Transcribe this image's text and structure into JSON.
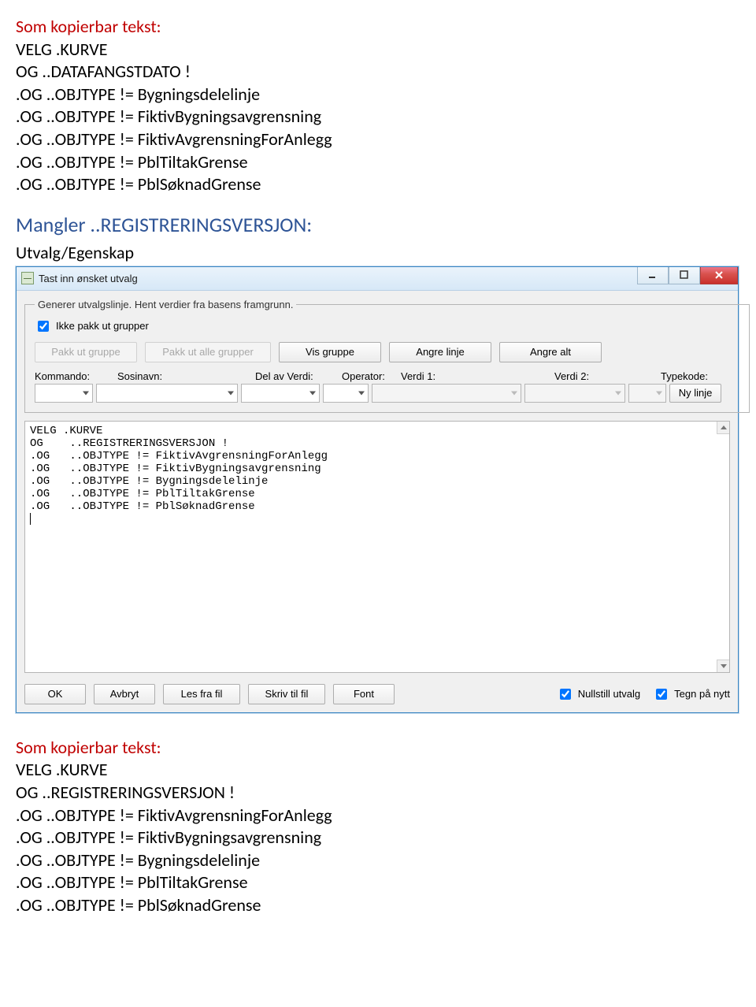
{
  "topBlock": {
    "heading": "Som kopierbar tekst:",
    "lines": [
      "VELG .KURVE",
      "OG   ..DATAFANGSTDATO !",
      ".OG   ..OBJTYPE != Bygningsdelelinje",
      ".OG   ..OBJTYPE != FiktivBygningsavgrensning",
      ".OG   ..OBJTYPE != FiktivAvgrensningForAnlegg",
      ".OG   ..OBJTYPE != PblTiltakGrense",
      ".OG   ..OBJTYPE != PblSøknadGrense"
    ]
  },
  "mangler": {
    "heading": "Mangler ..REGISTRERINGSVERSJON:",
    "sectionLabel": "Utvalg/Egenskap"
  },
  "dialog": {
    "title": "Tast inn ønsket utvalg",
    "group": {
      "legend": "Generer utvalgslinje. Hent verdier fra basens framgrunn.",
      "checkbox": "Ikke pakk ut grupper",
      "buttons": {
        "pakkUtGruppe": "Pakk ut gruppe",
        "pakkUtAlle": "Pakk ut alle grupper",
        "visGruppe": "Vis gruppe",
        "angreLinje": "Angre linje",
        "angreAlt": "Angre alt"
      },
      "labels": {
        "kommando": "Kommando:",
        "sosinavn": "Sosinavn:",
        "delAvVerdi": "Del av Verdi:",
        "operator": "Operator:",
        "verdi1": "Verdi 1:",
        "verdi2": "Verdi 2:",
        "typekode": "Typekode:"
      },
      "nyLinje": "Ny linje"
    },
    "textarea": "VELG .KURVE\nOG    ..REGISTRERINGSVERSJON !\n.OG   ..OBJTYPE != FiktivAvgrensningForAnlegg\n.OG   ..OBJTYPE != FiktivBygningsavgrensning\n.OG   ..OBJTYPE != Bygningsdelelinje\n.OG   ..OBJTYPE != PblTiltakGrense\n.OG   ..OBJTYPE != PblSøknadGrense\n",
    "bottom": {
      "ok": "OK",
      "avbryt": "Avbryt",
      "lesFraFil": "Les fra fil",
      "skrivTilFil": "Skriv til fil",
      "font": "Font",
      "nullstill": "Nullstill utvalg",
      "tegnPaNytt": "Tegn på nytt"
    }
  },
  "bottomBlock": {
    "heading": "Som kopierbar tekst:",
    "lines": [
      "VELG .KURVE",
      "OG   ..REGISTRERINGSVERSJON !",
      ".OG   ..OBJTYPE != FiktivAvgrensningForAnlegg",
      ".OG   ..OBJTYPE != FiktivBygningsavgrensning",
      ".OG   ..OBJTYPE != Bygningsdelelinje",
      ".OG   ..OBJTYPE != PblTiltakGrense",
      ".OG   ..OBJTYPE != PblSøknadGrense"
    ]
  }
}
